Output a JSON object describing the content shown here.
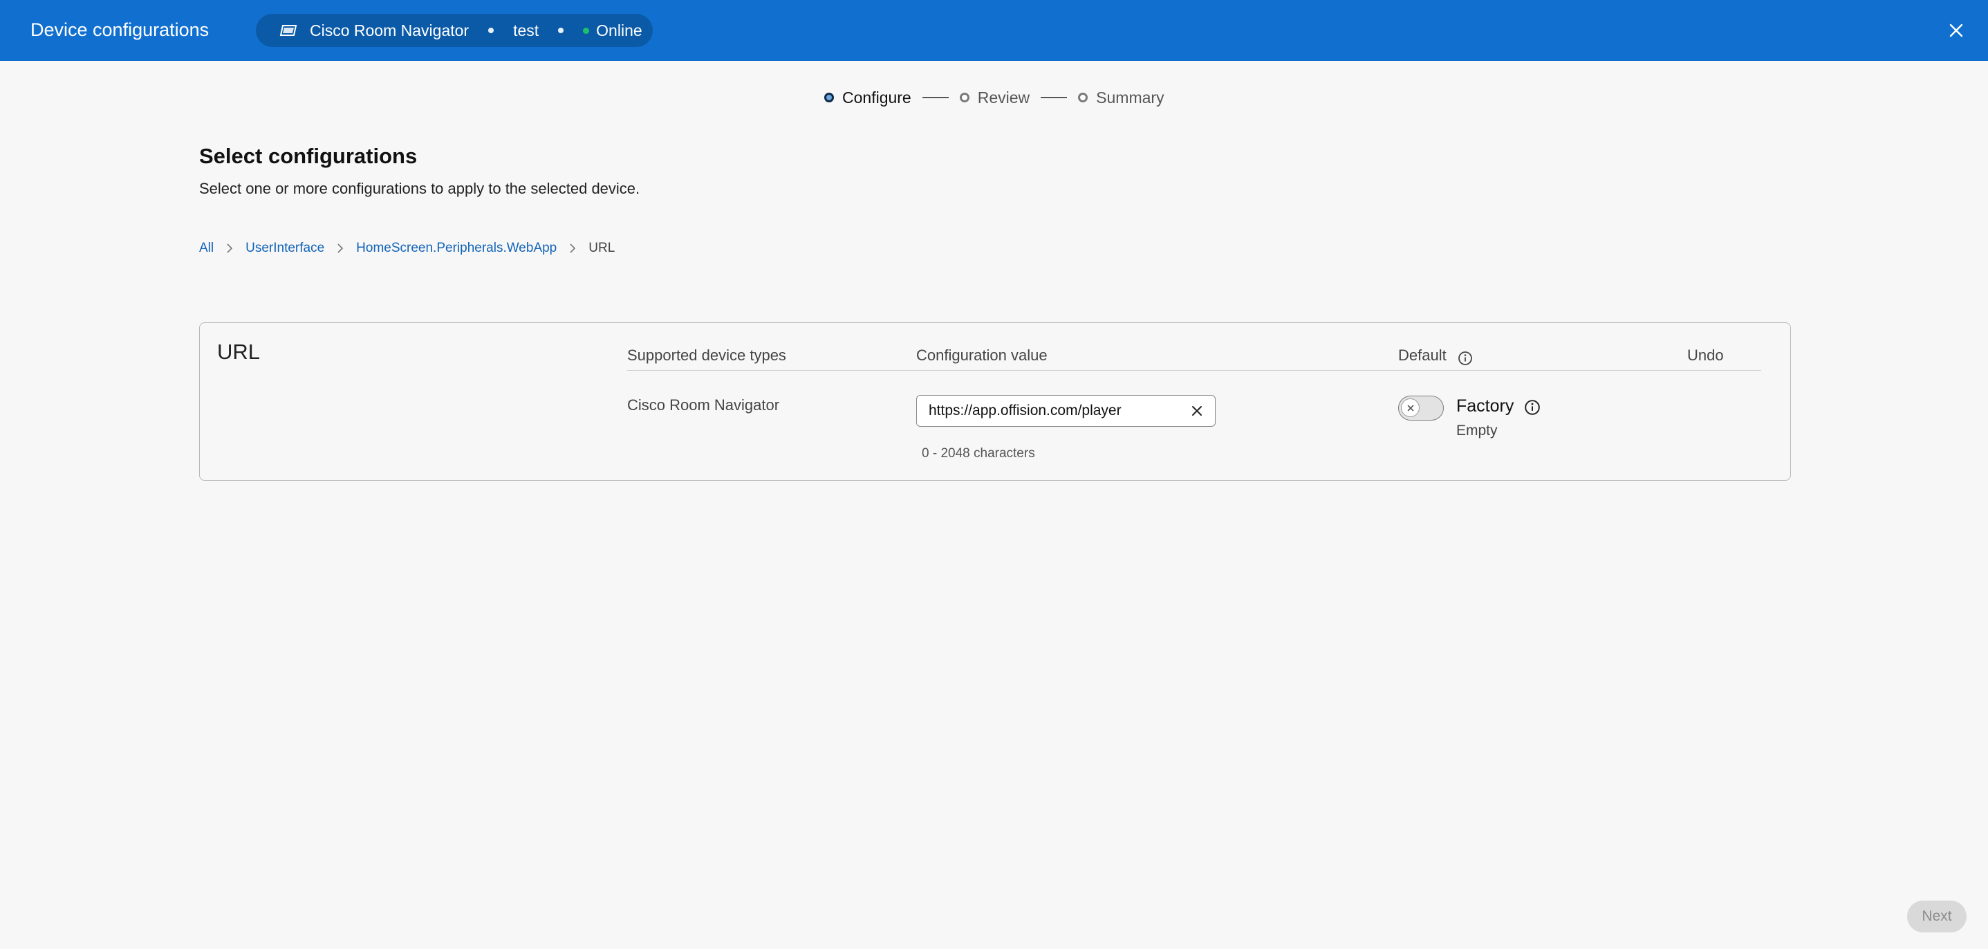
{
  "header": {
    "title": "Device configurations",
    "device": {
      "icon": "tablet-icon",
      "name": "Cisco Room Navigator",
      "workspace": "test",
      "status": "Online",
      "status_color": "#1fc06a"
    },
    "close_icon": "close-icon",
    "bar_color": "#1170cf"
  },
  "stepper": {
    "steps": [
      {
        "label": "Configure",
        "state": "active"
      },
      {
        "label": "Review",
        "state": "pending"
      },
      {
        "label": "Summary",
        "state": "pending"
      }
    ]
  },
  "page": {
    "heading": "Select configurations",
    "subheading": "Select one or more configurations to apply to the selected device."
  },
  "breadcrumb": {
    "items": [
      "All",
      "UserInterface",
      "HomeScreen.Peripherals.WebApp",
      "URL"
    ]
  },
  "config_card": {
    "title": "URL",
    "columns": {
      "device_types": "Supported device types",
      "config_value": "Configuration value",
      "default": "Default",
      "undo": "Undo"
    },
    "row": {
      "device_type": "Cisco Room Navigator",
      "value": "https://app.offision.com/player",
      "hint": "0 - 2048 characters",
      "default_toggle": "off",
      "default_source": "Factory",
      "default_value": "Empty"
    }
  },
  "footer": {
    "next_label": "Next"
  }
}
